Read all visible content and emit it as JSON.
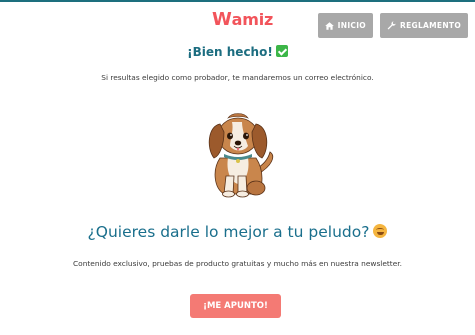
{
  "header": {
    "logo_first": "W",
    "logo_rest": "amiz",
    "nav": [
      {
        "label": "INICIO",
        "icon": "home-icon"
      },
      {
        "label": "REGLAMENTO",
        "icon": "wrench-icon"
      }
    ]
  },
  "success": {
    "title": "¡Bien hecho!",
    "icon": "check-mark-icon",
    "message": "Si resultas elegido como probador, te mandaremos un correo electrónico."
  },
  "illustration": {
    "icon": "puppy-illustration"
  },
  "promo": {
    "headline": "¿Quieres darle lo mejor a tu peludo?",
    "emoji": "star-struck-emoji",
    "description": "Contenido exclusivo, pruebas de producto gratuitas y mucho más en nuestra newsletter.",
    "cta_label": "¡ME APUNTO!"
  },
  "colors": {
    "brand": "#f2545b",
    "heading": "#1c6d80",
    "nav_button": "#a8a8a8",
    "cta": "#f47a74",
    "check": "#3cb648"
  }
}
